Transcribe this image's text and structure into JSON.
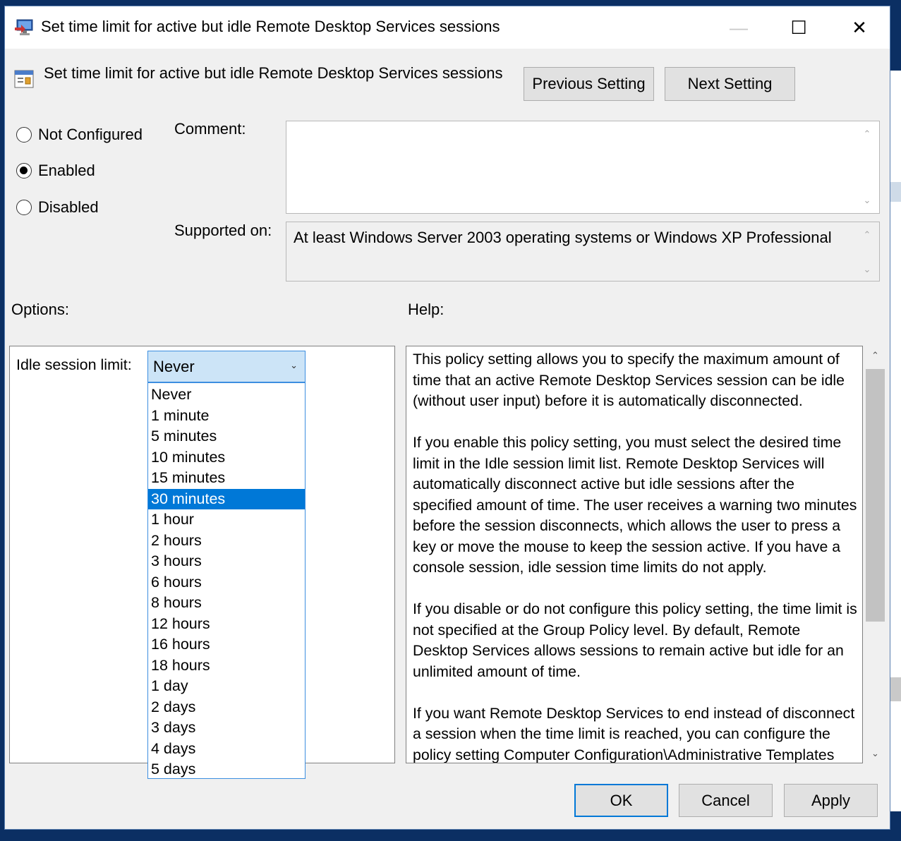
{
  "window": {
    "title": "Set time limit for active but idle Remote Desktop Services sessions",
    "min_glyph": "—",
    "max_glyph": "☐",
    "close_glyph": "✕"
  },
  "header": {
    "title": "Set time limit for active but idle Remote Desktop Services sessions",
    "previous_label": "Previous Setting",
    "next_label": "Next Setting"
  },
  "state": {
    "options": [
      {
        "label": "Not Configured",
        "checked": false
      },
      {
        "label": "Enabled",
        "checked": true
      },
      {
        "label": "Disabled",
        "checked": false
      }
    ]
  },
  "comment": {
    "label": "Comment:",
    "value": ""
  },
  "supported": {
    "label": "Supported on:",
    "value": "At least Windows Server 2003 operating systems or Windows XP Professional"
  },
  "options_section": {
    "label": "Options:",
    "idle_label": "Idle session limit:",
    "selected": "Never",
    "highlighted": "30 minutes",
    "items": [
      "Never",
      "1 minute",
      "5 minutes",
      "10 minutes",
      "15 minutes",
      "30 minutes",
      "1 hour",
      "2 hours",
      "3 hours",
      "6 hours",
      "8 hours",
      "12 hours",
      "16 hours",
      "18 hours",
      "1 day",
      "2 days",
      "3 days",
      "4 days",
      "5 days"
    ]
  },
  "help": {
    "label": "Help:",
    "paragraphs": [
      "This policy setting allows you to specify the maximum amount of time that an active Remote Desktop Services session can be idle (without user input) before it is automatically disconnected.",
      "If you enable this policy setting, you must select the desired time limit in the Idle session limit list. Remote Desktop Services will automatically disconnect active but idle sessions after the specified amount of time. The user receives a warning two minutes before the session disconnects, which allows the user to press a key or move the mouse to keep the session active. If you have a console session, idle session time limits do not apply.",
      "If you disable or do not configure this policy setting, the time limit is not specified at the Group Policy level. By default,  Remote Desktop Services allows sessions to remain active but idle for an unlimited amount of time.",
      "If you want Remote Desktop Services to end instead of disconnect a session when the time limit is reached, you can configure the policy setting Computer Configuration\\Administrative Templates"
    ]
  },
  "footer": {
    "ok_label": "OK",
    "cancel_label": "Cancel",
    "apply_label": "Apply"
  },
  "colors": {
    "selection": "#0078d7",
    "combo_bg": "#cce4f7",
    "dialog_bg": "#f0f0f0"
  }
}
